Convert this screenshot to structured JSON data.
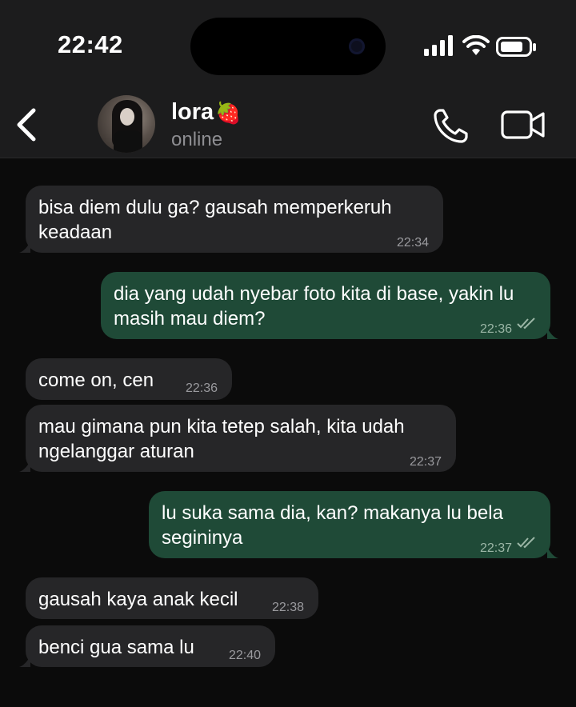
{
  "status_bar": {
    "time": "22:42"
  },
  "header": {
    "contact_name": "lora",
    "name_emoji": "🍓",
    "presence": "online",
    "icons": [
      "chevron-left-icon",
      "phone-icon",
      "video-camera-icon"
    ]
  },
  "messages": [
    {
      "direction": "in",
      "text": "bisa diem dulu ga? gausah memperkeruh keadaan",
      "time": "22:34"
    },
    {
      "direction": "out",
      "text": "dia yang udah nyebar foto kita di base, yakin lu masih mau diem?",
      "time": "22:36",
      "read": true
    },
    {
      "direction": "in",
      "text": "come on, cen",
      "time": "22:36"
    },
    {
      "direction": "in",
      "text": "mau gimana pun kita tetep salah, kita udah ngelanggar aturan",
      "time": "22:37"
    },
    {
      "direction": "out",
      "text": "lu suka sama dia, kan? makanya lu bela segininya",
      "time": "22:37",
      "read": true
    },
    {
      "direction": "in",
      "text": "gausah kaya anak kecil",
      "time": "22:38"
    },
    {
      "direction": "in",
      "text": "benci gua sama lu",
      "time": "22:40"
    }
  ],
  "colors": {
    "incoming_bubble": "#262628",
    "outgoing_bubble": "#1f4a37",
    "header_background": "#1c1c1d",
    "chat_background": "#0b0b0b"
  }
}
